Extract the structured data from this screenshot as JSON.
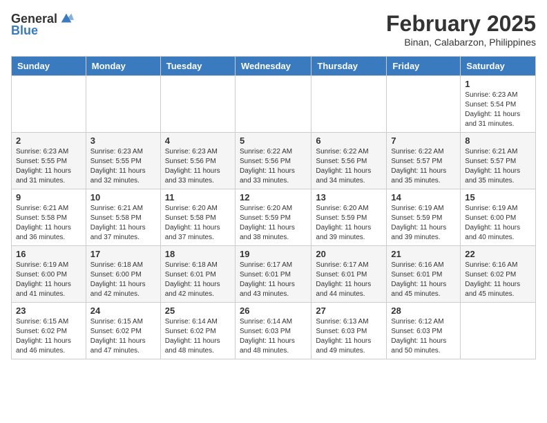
{
  "header": {
    "logo_general": "General",
    "logo_blue": "Blue",
    "month_title": "February 2025",
    "location": "Binan, Calabarzon, Philippines"
  },
  "days_of_week": [
    "Sunday",
    "Monday",
    "Tuesday",
    "Wednesday",
    "Thursday",
    "Friday",
    "Saturday"
  ],
  "weeks": [
    [
      {
        "day": "",
        "info": ""
      },
      {
        "day": "",
        "info": ""
      },
      {
        "day": "",
        "info": ""
      },
      {
        "day": "",
        "info": ""
      },
      {
        "day": "",
        "info": ""
      },
      {
        "day": "",
        "info": ""
      },
      {
        "day": "1",
        "info": "Sunrise: 6:23 AM\nSunset: 5:54 PM\nDaylight: 11 hours and 31 minutes."
      }
    ],
    [
      {
        "day": "2",
        "info": "Sunrise: 6:23 AM\nSunset: 5:55 PM\nDaylight: 11 hours and 31 minutes."
      },
      {
        "day": "3",
        "info": "Sunrise: 6:23 AM\nSunset: 5:55 PM\nDaylight: 11 hours and 32 minutes."
      },
      {
        "day": "4",
        "info": "Sunrise: 6:23 AM\nSunset: 5:56 PM\nDaylight: 11 hours and 33 minutes."
      },
      {
        "day": "5",
        "info": "Sunrise: 6:22 AM\nSunset: 5:56 PM\nDaylight: 11 hours and 33 minutes."
      },
      {
        "day": "6",
        "info": "Sunrise: 6:22 AM\nSunset: 5:56 PM\nDaylight: 11 hours and 34 minutes."
      },
      {
        "day": "7",
        "info": "Sunrise: 6:22 AM\nSunset: 5:57 PM\nDaylight: 11 hours and 35 minutes."
      },
      {
        "day": "8",
        "info": "Sunrise: 6:21 AM\nSunset: 5:57 PM\nDaylight: 11 hours and 35 minutes."
      }
    ],
    [
      {
        "day": "9",
        "info": "Sunrise: 6:21 AM\nSunset: 5:58 PM\nDaylight: 11 hours and 36 minutes."
      },
      {
        "day": "10",
        "info": "Sunrise: 6:21 AM\nSunset: 5:58 PM\nDaylight: 11 hours and 37 minutes."
      },
      {
        "day": "11",
        "info": "Sunrise: 6:20 AM\nSunset: 5:58 PM\nDaylight: 11 hours and 37 minutes."
      },
      {
        "day": "12",
        "info": "Sunrise: 6:20 AM\nSunset: 5:59 PM\nDaylight: 11 hours and 38 minutes."
      },
      {
        "day": "13",
        "info": "Sunrise: 6:20 AM\nSunset: 5:59 PM\nDaylight: 11 hours and 39 minutes."
      },
      {
        "day": "14",
        "info": "Sunrise: 6:19 AM\nSunset: 5:59 PM\nDaylight: 11 hours and 39 minutes."
      },
      {
        "day": "15",
        "info": "Sunrise: 6:19 AM\nSunset: 6:00 PM\nDaylight: 11 hours and 40 minutes."
      }
    ],
    [
      {
        "day": "16",
        "info": "Sunrise: 6:19 AM\nSunset: 6:00 PM\nDaylight: 11 hours and 41 minutes."
      },
      {
        "day": "17",
        "info": "Sunrise: 6:18 AM\nSunset: 6:00 PM\nDaylight: 11 hours and 42 minutes."
      },
      {
        "day": "18",
        "info": "Sunrise: 6:18 AM\nSunset: 6:01 PM\nDaylight: 11 hours and 42 minutes."
      },
      {
        "day": "19",
        "info": "Sunrise: 6:17 AM\nSunset: 6:01 PM\nDaylight: 11 hours and 43 minutes."
      },
      {
        "day": "20",
        "info": "Sunrise: 6:17 AM\nSunset: 6:01 PM\nDaylight: 11 hours and 44 minutes."
      },
      {
        "day": "21",
        "info": "Sunrise: 6:16 AM\nSunset: 6:01 PM\nDaylight: 11 hours and 45 minutes."
      },
      {
        "day": "22",
        "info": "Sunrise: 6:16 AM\nSunset: 6:02 PM\nDaylight: 11 hours and 45 minutes."
      }
    ],
    [
      {
        "day": "23",
        "info": "Sunrise: 6:15 AM\nSunset: 6:02 PM\nDaylight: 11 hours and 46 minutes."
      },
      {
        "day": "24",
        "info": "Sunrise: 6:15 AM\nSunset: 6:02 PM\nDaylight: 11 hours and 47 minutes."
      },
      {
        "day": "25",
        "info": "Sunrise: 6:14 AM\nSunset: 6:02 PM\nDaylight: 11 hours and 48 minutes."
      },
      {
        "day": "26",
        "info": "Sunrise: 6:14 AM\nSunset: 6:03 PM\nDaylight: 11 hours and 48 minutes."
      },
      {
        "day": "27",
        "info": "Sunrise: 6:13 AM\nSunset: 6:03 PM\nDaylight: 11 hours and 49 minutes."
      },
      {
        "day": "28",
        "info": "Sunrise: 6:12 AM\nSunset: 6:03 PM\nDaylight: 11 hours and 50 minutes."
      },
      {
        "day": "",
        "info": ""
      }
    ]
  ]
}
